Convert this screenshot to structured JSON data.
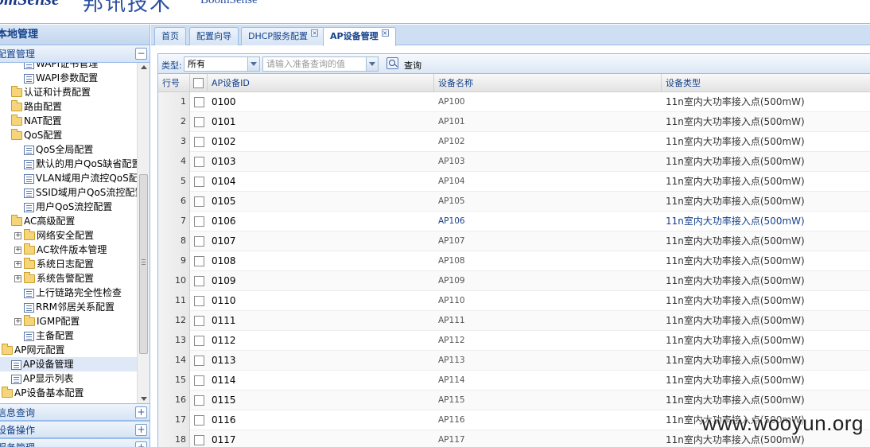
{
  "header": {
    "logo": "omSense",
    "brand_cn": "邦讯技术",
    "brand_en": "BoomSense"
  },
  "left_panel": {
    "title": "本地管理",
    "top_section": "配置管理",
    "tree": [
      {
        "label": "WAPI证书管理",
        "icon": "leaf",
        "level": 2
      },
      {
        "label": "WAPI参数配置",
        "icon": "leaf",
        "level": 2
      },
      {
        "label": "认证和计费配置",
        "icon": "folder",
        "level": 1
      },
      {
        "label": "路由配置",
        "icon": "folder",
        "level": 1
      },
      {
        "label": "NAT配置",
        "icon": "folder",
        "level": 1
      },
      {
        "label": "QoS配置",
        "icon": "folder",
        "level": 1
      },
      {
        "label": "QoS全局配置",
        "icon": "leaf",
        "level": 2
      },
      {
        "label": "默认的用户QoS缺省配置",
        "icon": "leaf",
        "level": 2
      },
      {
        "label": "VLAN域用户流控QoS配置",
        "icon": "leaf",
        "level": 2
      },
      {
        "label": "SSID域用户QoS流控配置",
        "icon": "leaf",
        "level": 2
      },
      {
        "label": "用户QoS流控配置",
        "icon": "leaf",
        "level": 2
      },
      {
        "label": "AC高级配置",
        "icon": "folder",
        "level": 1
      },
      {
        "label": "网络安全配置",
        "icon": "folder-plus",
        "level": 2
      },
      {
        "label": "AC软件版本管理",
        "icon": "folder-plus",
        "level": 2
      },
      {
        "label": "系统日志配置",
        "icon": "folder-plus",
        "level": 2
      },
      {
        "label": "系统告警配置",
        "icon": "folder-plus",
        "level": 2
      },
      {
        "label": "上行链路完全性检查",
        "icon": "leaf",
        "level": 2
      },
      {
        "label": "RRM邻居关系配置",
        "icon": "leaf",
        "level": 2
      },
      {
        "label": "IGMP配置",
        "icon": "folder-plus",
        "level": 2
      },
      {
        "label": "主备配置",
        "icon": "leaf",
        "level": 2
      },
      {
        "label": "AP网元配置",
        "icon": "folder",
        "level": 0
      },
      {
        "label": "AP设备管理",
        "icon": "leaf",
        "level": 1,
        "selected": true
      },
      {
        "label": "AP显示列表",
        "icon": "leaf",
        "level": 1
      },
      {
        "label": "AP设备基本配置",
        "icon": "folder",
        "level": 0
      }
    ],
    "sections": [
      {
        "label": "信息查询"
      },
      {
        "label": "设备操作"
      },
      {
        "label": "服务管理"
      }
    ],
    "collapse_symbol": "−",
    "expand_symbol": "+"
  },
  "tabs": [
    {
      "label": "首页",
      "closable": false,
      "active": false
    },
    {
      "label": "配置向导",
      "closable": false,
      "active": false
    },
    {
      "label": "DHCP服务配置",
      "closable": true,
      "active": false
    },
    {
      "label": "AP设备管理",
      "closable": true,
      "active": true
    }
  ],
  "tab_close_symbol": "×",
  "toolbar": {
    "type_label": "类型:",
    "type_value": "所有",
    "query_placeholder": "请输入准备查询的值",
    "search_label": "查询"
  },
  "grid": {
    "columns": [
      "行号",
      "",
      "AP设备ID",
      "设备名称",
      "设备类型"
    ],
    "rows": [
      {
        "n": "1",
        "id": "0100",
        "name": "AP100",
        "type": "11n室内大功率接入点(500mW)"
      },
      {
        "n": "2",
        "id": "0101",
        "name": "AP101",
        "type": "11n室内大功率接入点(500mW)"
      },
      {
        "n": "3",
        "id": "0102",
        "name": "AP102",
        "type": "11n室内大功率接入点(500mW)"
      },
      {
        "n": "4",
        "id": "0103",
        "name": "AP103",
        "type": "11n室内大功率接入点(500mW)"
      },
      {
        "n": "5",
        "id": "0104",
        "name": "AP104",
        "type": "11n室内大功率接入点(500mW)"
      },
      {
        "n": "6",
        "id": "0105",
        "name": "AP105",
        "type": "11n室内大功率接入点(500mW)"
      },
      {
        "n": "7",
        "id": "0106",
        "name": "AP106",
        "type": "11n室内大功率接入点(500mW)",
        "highlight": true
      },
      {
        "n": "8",
        "id": "0107",
        "name": "AP107",
        "type": "11n室内大功率接入点(500mW)"
      },
      {
        "n": "9",
        "id": "0108",
        "name": "AP108",
        "type": "11n室内大功率接入点(500mW)"
      },
      {
        "n": "10",
        "id": "0109",
        "name": "AP109",
        "type": "11n室内大功率接入点(500mW)"
      },
      {
        "n": "11",
        "id": "0110",
        "name": "AP110",
        "type": "11n室内大功率接入点(500mW)"
      },
      {
        "n": "12",
        "id": "0111",
        "name": "AP111",
        "type": "11n室内大功率接入点(500mW)"
      },
      {
        "n": "13",
        "id": "0112",
        "name": "AP112",
        "type": "11n室内大功率接入点(500mW)"
      },
      {
        "n": "14",
        "id": "0113",
        "name": "AP113",
        "type": "11n室内大功率接入点(500mW)"
      },
      {
        "n": "15",
        "id": "0114",
        "name": "AP114",
        "type": "11n室内大功率接入点(500mW)"
      },
      {
        "n": "16",
        "id": "0115",
        "name": "AP115",
        "type": "11n室内大功率接入点(500mW)"
      },
      {
        "n": "17",
        "id": "0116",
        "name": "AP116",
        "type": "11n室内大功率接入点(500mW)"
      },
      {
        "n": "18",
        "id": "0117",
        "name": "AP117",
        "type": "11n室内大功率接入点(500mW)"
      }
    ]
  },
  "watermark": "www.wooyun.org",
  "colors": {
    "accent": "#15428b",
    "border": "#99bbe8",
    "selected": "#dfe8f6"
  }
}
